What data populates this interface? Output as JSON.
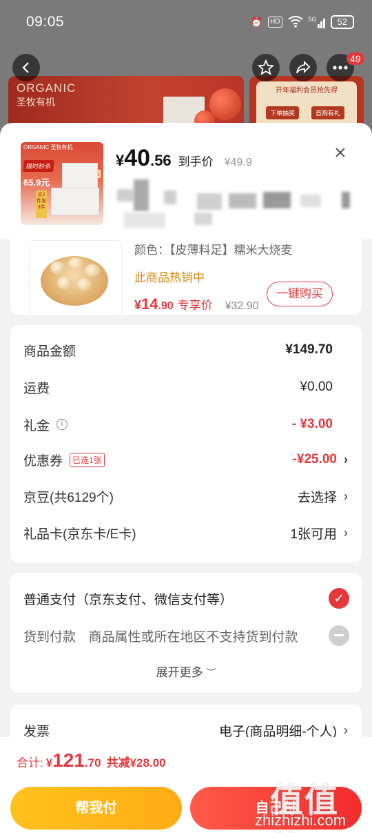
{
  "status_bar": {
    "time": "09:05",
    "hd_label": "HD",
    "network_label": "5G",
    "battery": "52"
  },
  "top_nav": {
    "back_icon": "chevron-left-icon",
    "star_icon": "star-icon",
    "share_icon": "share-icon",
    "more_icon": "more-icon",
    "badge_count": "49"
  },
  "banner": {
    "brand_en": "ORGANIC",
    "brand_cn": "圣牧有机",
    "right_title": "开年福利会员抢先得",
    "right_chip_1": "下单抽奖",
    "right_chip_2": "首购有礼"
  },
  "sheet_header": {
    "thumb": {
      "brand": "ORGANIC 圣牧有机",
      "tag": "限时秒杀",
      "price": "65.9元",
      "side_text": "买2件发3件",
      "count_tag": "24盒"
    },
    "price_currency": "¥",
    "price_int": "40",
    "price_dec": ".56",
    "price_label": "到手价",
    "original_price": "¥49.9",
    "close_icon": "close-icon"
  },
  "product": {
    "variant": "颜色：【皮薄料足】糯米大烧麦",
    "hot_text": "此商品热销中",
    "deal_currency": "¥",
    "deal_int": "14",
    "deal_dec": ".90",
    "deal_label": "专享价",
    "deal_original": "¥32.90",
    "buy_label": "一键购买"
  },
  "summary": {
    "goods_amount": {
      "label": "商品金额",
      "value": "¥149.70"
    },
    "shipping": {
      "label": "运费",
      "value": "¥0.00"
    },
    "gift_money": {
      "label": "礼金",
      "value": "- ¥3.00"
    },
    "coupon": {
      "label": "优惠券",
      "tag": "已选1张",
      "value": "-¥25.00"
    },
    "jd_beans": {
      "label": "京豆(共6129个)",
      "value": "去选择"
    },
    "gift_card": {
      "label": "礼品卡(京东卡/E卡)",
      "value": "1张可用"
    }
  },
  "payment": {
    "normal": "普通支付（京东支付、微信支付等）",
    "cod_title": "货到付款",
    "cod_note": "商品属性或所在地区不支持货到付款",
    "expand_more": "展开更多"
  },
  "invoice": {
    "label": "发票",
    "value": "电子(商品明细-个人)"
  },
  "bottom": {
    "total_label": "合计:",
    "total_currency": "¥",
    "total_int": "121",
    "total_dec": ".70",
    "total_saving": "共减¥28.00",
    "help_pay": "帮我付",
    "self_pay": "自己付"
  },
  "watermark": {
    "big": "值值值",
    "site": "zhizhizhi.com"
  },
  "colors": {
    "accent_red": "#e4393c",
    "help_yellow": "#ffb318",
    "hot_orange": "#d98a18"
  }
}
